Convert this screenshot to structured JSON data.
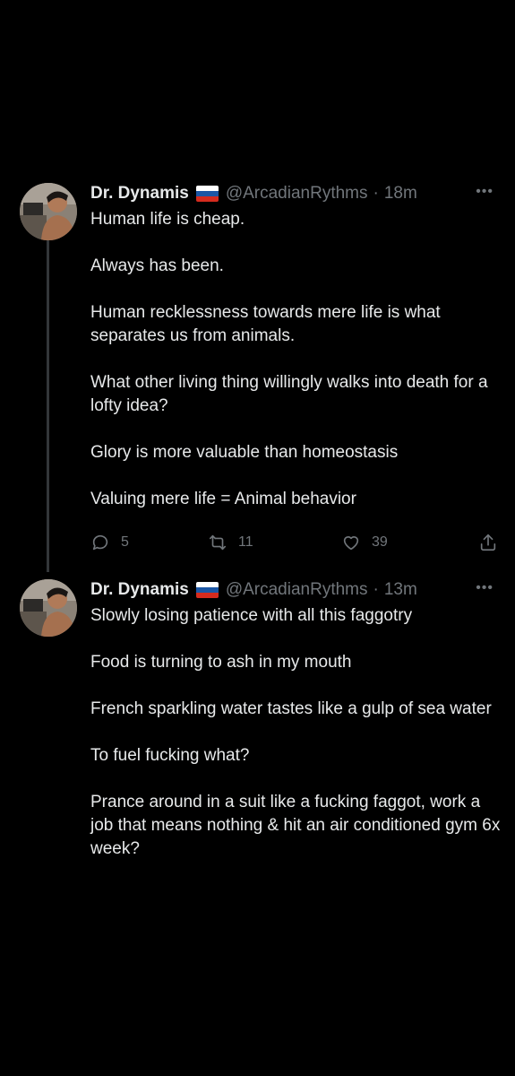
{
  "tweets": [
    {
      "name": "Dr. Dynamis",
      "handle": "@ArcadianRythms",
      "separator": "·",
      "time": "18m",
      "flag_colors": [
        "#ffffff",
        "#1c57a5",
        "#d52b1e"
      ],
      "paragraphs": [
        "Human life is cheap.",
        "Always has been.",
        "Human recklessness towards mere life is what separates us from animals.",
        "What other living thing willingly walks into death for a lofty idea?",
        "Glory is more valuable than homeostasis",
        "Valuing mere life = Animal behavior"
      ],
      "replies": "5",
      "retweets": "11",
      "likes": "39"
    },
    {
      "name": "Dr. Dynamis",
      "handle": "@ArcadianRythms",
      "separator": "·",
      "time": "13m",
      "flag_colors": [
        "#ffffff",
        "#1c57a5",
        "#d52b1e"
      ],
      "paragraphs": [
        "Slowly losing patience with all this faggotry",
        "Food is turning to ash in my mouth",
        "French sparkling water tastes like a gulp of sea water",
        "To fuel fucking what?",
        "Prance around in a suit like a fucking faggot, work a job that means nothing & hit an air conditioned  gym 6x week?"
      ]
    }
  ],
  "icons": {
    "more": "more-horizontal-icon",
    "reply": "reply-icon",
    "retweet": "retweet-icon",
    "like": "heart-icon",
    "share": "share-icon"
  },
  "colors": {
    "background": "#000000",
    "text": "#e7e9ea",
    "secondary": "#71767b",
    "thread_line": "#333639"
  }
}
